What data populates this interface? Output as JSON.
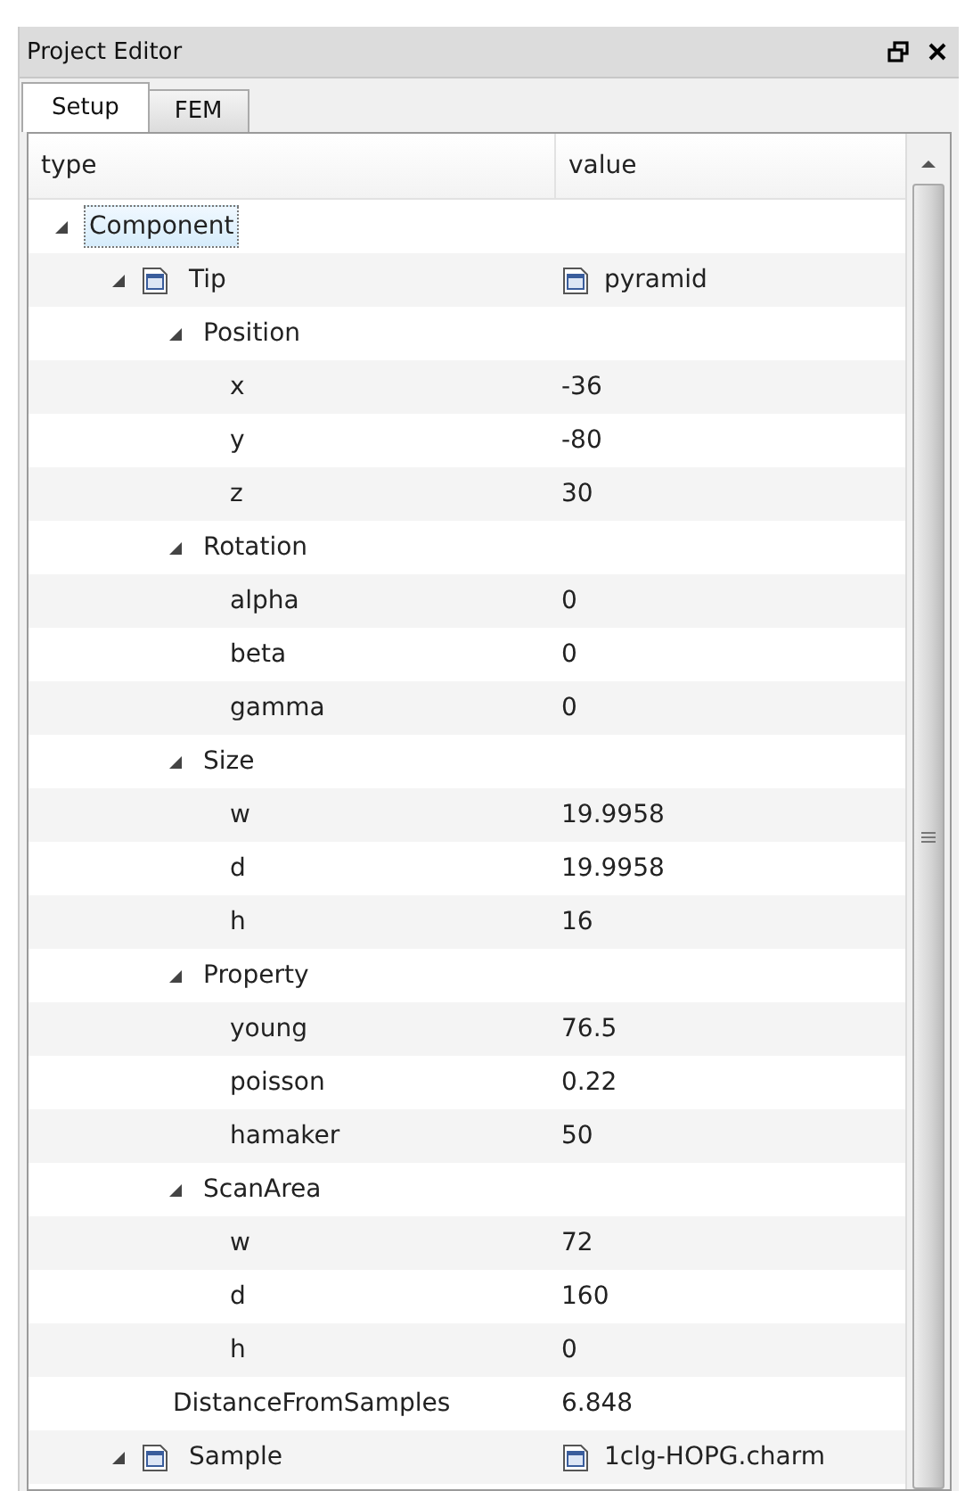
{
  "window": {
    "title": "Project Editor"
  },
  "tabs": [
    {
      "label": "Setup",
      "selected": true
    },
    {
      "label": "FEM",
      "selected": false
    }
  ],
  "tree": {
    "columns": [
      "type",
      "value"
    ],
    "nodes": [
      {
        "type": "Component",
        "kind": "group",
        "expanded": true,
        "selected": true,
        "children": [
          {
            "type": "Tip",
            "value": "pyramid",
            "kind": "object",
            "expanded": true,
            "selected": false,
            "children": [
              {
                "type": "Position",
                "kind": "group",
                "expanded": true,
                "selected": false,
                "children": [
                  {
                    "type": "x",
                    "value": "-36",
                    "kind": "leaf",
                    "selected": false
                  },
                  {
                    "type": "y",
                    "value": "-80",
                    "kind": "leaf",
                    "selected": false
                  },
                  {
                    "type": "z",
                    "value": "30",
                    "kind": "leaf",
                    "selected": false
                  }
                ]
              },
              {
                "type": "Rotation",
                "kind": "group",
                "expanded": true,
                "selected": false,
                "children": [
                  {
                    "type": "alpha",
                    "value": "0",
                    "kind": "leaf",
                    "selected": false
                  },
                  {
                    "type": "beta",
                    "value": "0",
                    "kind": "leaf",
                    "selected": false
                  },
                  {
                    "type": "gamma",
                    "value": "0",
                    "kind": "leaf",
                    "selected": false
                  }
                ]
              },
              {
                "type": "Size",
                "kind": "group",
                "expanded": true,
                "selected": false,
                "children": [
                  {
                    "type": "w",
                    "value": "19.9958",
                    "kind": "leaf",
                    "selected": false
                  },
                  {
                    "type": "d",
                    "value": "19.9958",
                    "kind": "leaf",
                    "selected": false
                  },
                  {
                    "type": "h",
                    "value": "16",
                    "kind": "leaf",
                    "selected": false
                  }
                ]
              },
              {
                "type": "Property",
                "kind": "group",
                "expanded": true,
                "selected": false,
                "children": [
                  {
                    "type": "young",
                    "value": "76.5",
                    "kind": "leaf",
                    "selected": false
                  },
                  {
                    "type": "poisson",
                    "value": "0.22",
                    "kind": "leaf",
                    "selected": false
                  },
                  {
                    "type": "hamaker",
                    "value": "50",
                    "kind": "leaf",
                    "selected": false
                  }
                ]
              },
              {
                "type": "ScanArea",
                "kind": "group",
                "expanded": true,
                "selected": false,
                "children": [
                  {
                    "type": "w",
                    "value": "72",
                    "kind": "leaf",
                    "selected": false
                  },
                  {
                    "type": "d",
                    "value": "160",
                    "kind": "leaf",
                    "selected": false
                  },
                  {
                    "type": "h",
                    "value": "0",
                    "kind": "leaf",
                    "selected": false
                  }
                ]
              },
              {
                "type": "DistanceFromSamples",
                "value": "6.848",
                "kind": "leaf",
                "selected": false
              }
            ]
          },
          {
            "type": "Sample",
            "value": "1clg-HOPG.charm",
            "kind": "object",
            "expanded": true,
            "selected": false
          }
        ]
      }
    ]
  }
}
